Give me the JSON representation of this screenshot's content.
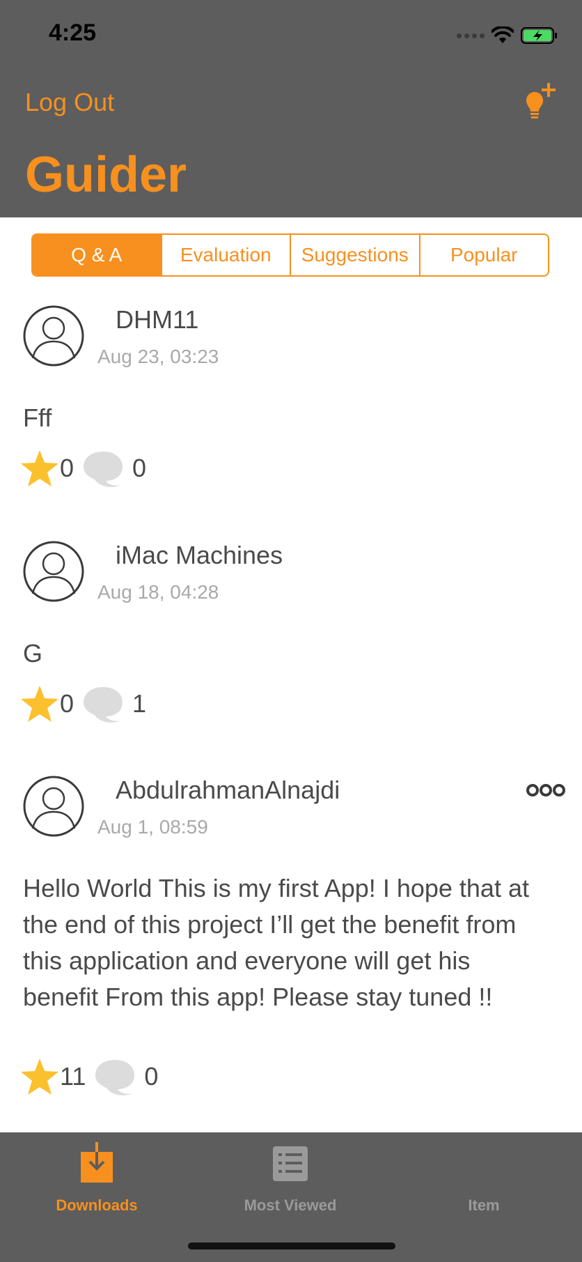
{
  "status_bar": {
    "time": "4:25"
  },
  "nav": {
    "left_button": "Log Out",
    "title": "Guider"
  },
  "segments": [
    {
      "label": "Q & A",
      "active": true
    },
    {
      "label": "Evaluation",
      "active": false
    },
    {
      "label": "Suggestions",
      "active": false
    },
    {
      "label": "Popular",
      "active": false
    }
  ],
  "posts": [
    {
      "username": "DHM11",
      "date": "Aug 23, 03:23",
      "text": "Fff",
      "stars": "0",
      "comments": "0"
    },
    {
      "username": "iMac Machines",
      "date": "Aug 18, 04:28",
      "text": "G",
      "stars": "0",
      "comments": "1"
    },
    {
      "username": "AbdulrahmanAlnajdi",
      "date": "Aug 1, 08:59",
      "text": "Hello World This is my first App! I hope that at the end of this project I’ll get the benefit from this application and everyone will get his benefit From this app! Please stay tuned !!",
      "stars": "11",
      "comments": "0"
    }
  ],
  "tabbar": {
    "tabs": [
      {
        "label": "Downloads",
        "icon": "download-icon",
        "active": true
      },
      {
        "label": "Most Viewed",
        "icon": "list-icon",
        "active": false
      },
      {
        "label": "Item",
        "icon": "",
        "active": false
      }
    ]
  },
  "colors": {
    "accent": "#f7901e",
    "bar": "#5d5d5d",
    "star": "#fbc02d",
    "inactive_tab": "#9a9a9a"
  }
}
